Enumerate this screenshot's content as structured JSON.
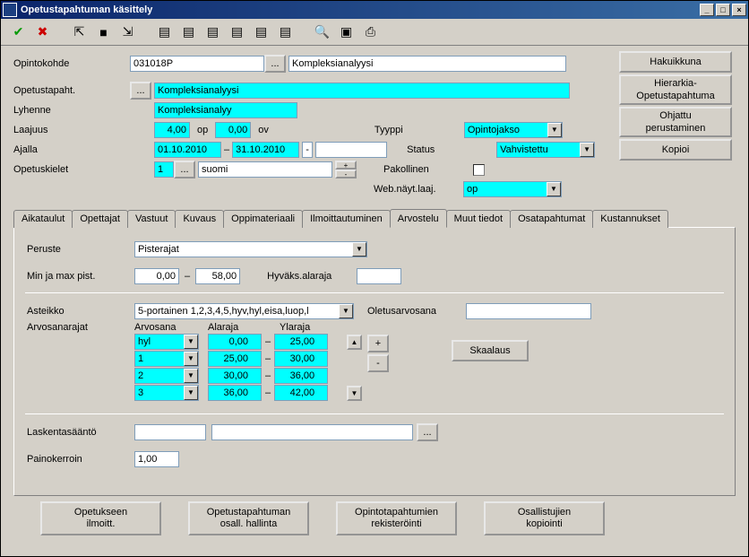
{
  "window": {
    "title": "Opetustapahtuman käsittely"
  },
  "winbtns": {
    "min": "_",
    "max": "□",
    "close": "×"
  },
  "fields": {
    "opintokohde_lbl": "Opintokohde",
    "opintokohde_code": "031018P",
    "opintokohde_name": "Kompleksianalyysi",
    "opetustapaht_lbl": "Opetustapaht.",
    "opetustapaht_val": "Kompleksianalyysi",
    "lyhenne_lbl": "Lyhenne",
    "lyhenne_val": "Kompleksianalyy",
    "laajuus_lbl": "Laajuus",
    "laajuus_op": "4,00",
    "op": "op",
    "laajuus_ov": "0,00",
    "ov": "ov",
    "ajalla_lbl": "Ajalla",
    "ajalla_from": "01.10.2010",
    "ajalla_to": "31.10.2010",
    "ajalla_extra": "-",
    "opetuskielet_lbl": "Opetuskielet",
    "opetuskielet_n": "1",
    "opetuskielet_lang": "suomi",
    "tyyppi_lbl": "Tyyppi",
    "tyyppi_val": "Opintojakso",
    "status_lbl": "Status",
    "status_val": "Vahvistettu",
    "pakollinen_lbl": "Pakollinen",
    "webnayt_lbl": "Web.näyt.laaj.",
    "webnayt_val": "op",
    "dots": "..."
  },
  "sidebar": {
    "haku": "Hakuikkuna",
    "hier1": "Hierarkia-",
    "hier2": "Opetustapahtuma",
    "ohj1": "Ohjattu",
    "ohj2": "perustaminen",
    "kopioi": "Kopioi"
  },
  "tabs": [
    "Aikataulut",
    "Opettajat",
    "Vastuut",
    "Kuvaus",
    "Oppimateriaali",
    "Ilmoittautuminen",
    "Arvostelu",
    "Muut tiedot",
    "Osatapahtumat",
    "Kustannukset"
  ],
  "active_tab": 6,
  "arvostelu": {
    "peruste_lbl": "Peruste",
    "peruste_val": "Pisterajat",
    "minmax_lbl": "Min ja max pist.",
    "min": "0,00",
    "dash": "–",
    "max": "58,00",
    "hyvaks_lbl": "Hyväks.alaraja",
    "hyvaks_val": "",
    "asteikko_lbl": "Asteikko",
    "asteikko_val": "5-portainen 1,2,3,4,5,hyv,hyl,eisa,luop,l",
    "oletus_lbl": "Oletusarvosana",
    "oletus_val": "",
    "arvosanarajat_lbl": "Arvosanarajat",
    "h_arvosana": "Arvosana",
    "h_alaraja": "Alaraja",
    "h_ylaraja": "Ylaraja",
    "rows": [
      {
        "g": "hyl",
        "lo": "0,00",
        "hi": "25,00"
      },
      {
        "g": "1",
        "lo": "25,00",
        "hi": "30,00"
      },
      {
        "g": "2",
        "lo": "30,00",
        "hi": "36,00"
      },
      {
        "g": "3",
        "lo": "36,00",
        "hi": "42,00"
      }
    ],
    "plus": "+",
    "minus": "-",
    "skaalaus": "Skaalaus",
    "laskenta_lbl": "Laskentasääntö",
    "painokerroin_lbl": "Painokerroin",
    "painokerroin_val": "1,00"
  },
  "footer": {
    "b1a": "Opetukseen",
    "b1b": "ilmoitt.",
    "b2a": "Opetustapahtuman",
    "b2b": "osall. hallinta",
    "b3a": "Opintotapahtumien",
    "b3b": "rekisteröinti",
    "b4a": "Osallistujien",
    "b4b": "kopiointi"
  },
  "icons": {
    "check": "✔",
    "x": "✖",
    "goto": "⇱",
    "save": "■",
    "export": "⇲",
    "nav1": "▤",
    "nav2": "▤",
    "nav3": "▤",
    "nav4": "▤",
    "nav5": "▤",
    "nav6": "▤",
    "search": "🔍",
    "sheet": "▣",
    "print": "⎙",
    "up": "▲",
    "down": "▼"
  }
}
